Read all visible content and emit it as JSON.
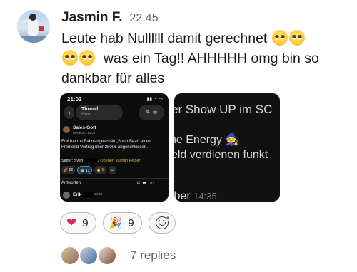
{
  "author": "Jasmin F.",
  "time": "22:45",
  "message": {
    "line1": "Leute hab Nullllll damit gerechnet",
    "line2": "was ein Tag!! AHHHHH omg bin so",
    "line3": "dankbar für alles"
  },
  "screenshot1": {
    "status_time": "21:02",
    "title": "Thread",
    "subtitle": "#wins",
    "sender": "Sales-Gott",
    "sender_time": "heute um 14:02",
    "post_text": "Erik hat mit Fahrradgeschäft „Sport Beat“ einen Frontend-Vertrag über 2800€ abgeschlossen.",
    "setter_label": "Setter: Sven",
    "opener_label": "/ Opener: Jasmin Felber",
    "reaction_counts": [
      "22",
      "13",
      "6"
    ],
    "answers_label": "Antworten",
    "erik": "Erik",
    "erik_time": "14:03"
  },
  "screenshot2": {
    "line1": "er Show UP im SC",
    "line2": "ne Energy",
    "line3": "eld verdienen funkt",
    "line4": "lber",
    "time": "14:35"
  },
  "reactions": [
    {
      "icon": "heart",
      "count": "9"
    },
    {
      "icon": "party-popper",
      "count": "9"
    }
  ],
  "replies": {
    "label": "7 replies"
  }
}
